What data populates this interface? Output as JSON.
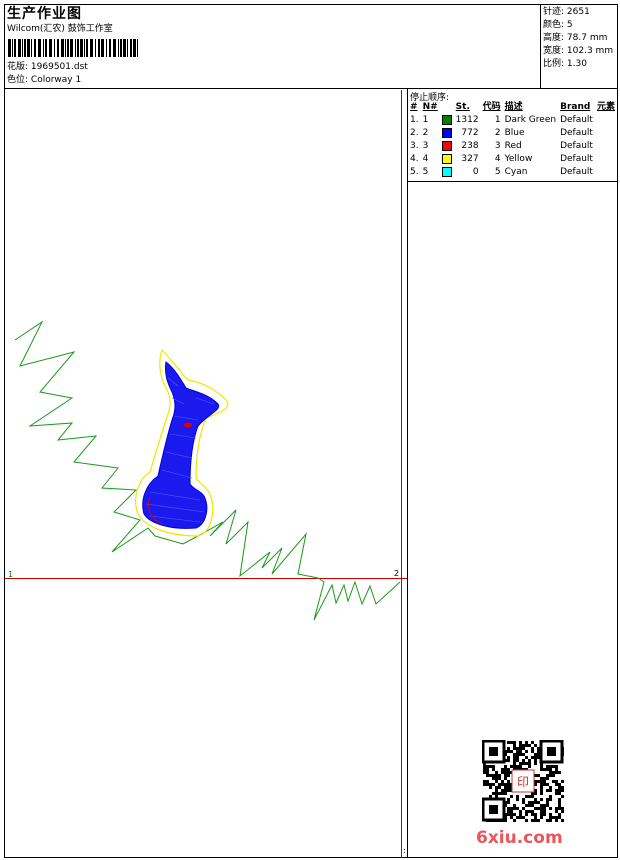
{
  "header": {
    "title": "生产作业图",
    "company": "Wilcom(汇农) 鼓饰工作室",
    "design_label": "花版:",
    "design_value": "1969501.dst",
    "colorway_label": "色位:",
    "colorway_value": "Colorway 1"
  },
  "stats": [
    {
      "label": "针迹:",
      "value": "2651"
    },
    {
      "label": "颜色:",
      "value": "5"
    },
    {
      "label": "高度:",
      "value": "78.7 mm"
    },
    {
      "label": "宽度:",
      "value": "102.3 mm"
    },
    {
      "label": "比例:",
      "value": "1.30"
    }
  ],
  "sequence": {
    "title": "停止顺序:",
    "headers": [
      "#",
      "N#",
      "St.",
      "代码",
      "描述",
      "Brand",
      "元素"
    ],
    "rows": [
      {
        "idx": "1.",
        "n": "1",
        "st": "1312",
        "code": "1",
        "desc": "Dark Green",
        "brand": "Default",
        "color": "#008000"
      },
      {
        "idx": "2.",
        "n": "2",
        "st": "772",
        "code": "2",
        "desc": "Blue",
        "brand": "Default",
        "color": "#0000ff"
      },
      {
        "idx": "3.",
        "n": "3",
        "st": "238",
        "code": "3",
        "desc": "Red",
        "brand": "Default",
        "color": "#ff0000"
      },
      {
        "idx": "4.",
        "n": "4",
        "st": "327",
        "code": "4",
        "desc": "Yellow",
        "brand": "Default",
        "color": "#ffff00"
      },
      {
        "idx": "5.",
        "n": "5",
        "st": "0",
        "code": "5",
        "desc": "Cyan",
        "brand": "Default",
        "color": "#00ffff"
      }
    ]
  },
  "canvas": {
    "marker_left": "1",
    "marker_right": "2",
    "marker_corner": ":"
  },
  "watermark": {
    "brand": "6xiu.com",
    "seal_text": "印"
  }
}
